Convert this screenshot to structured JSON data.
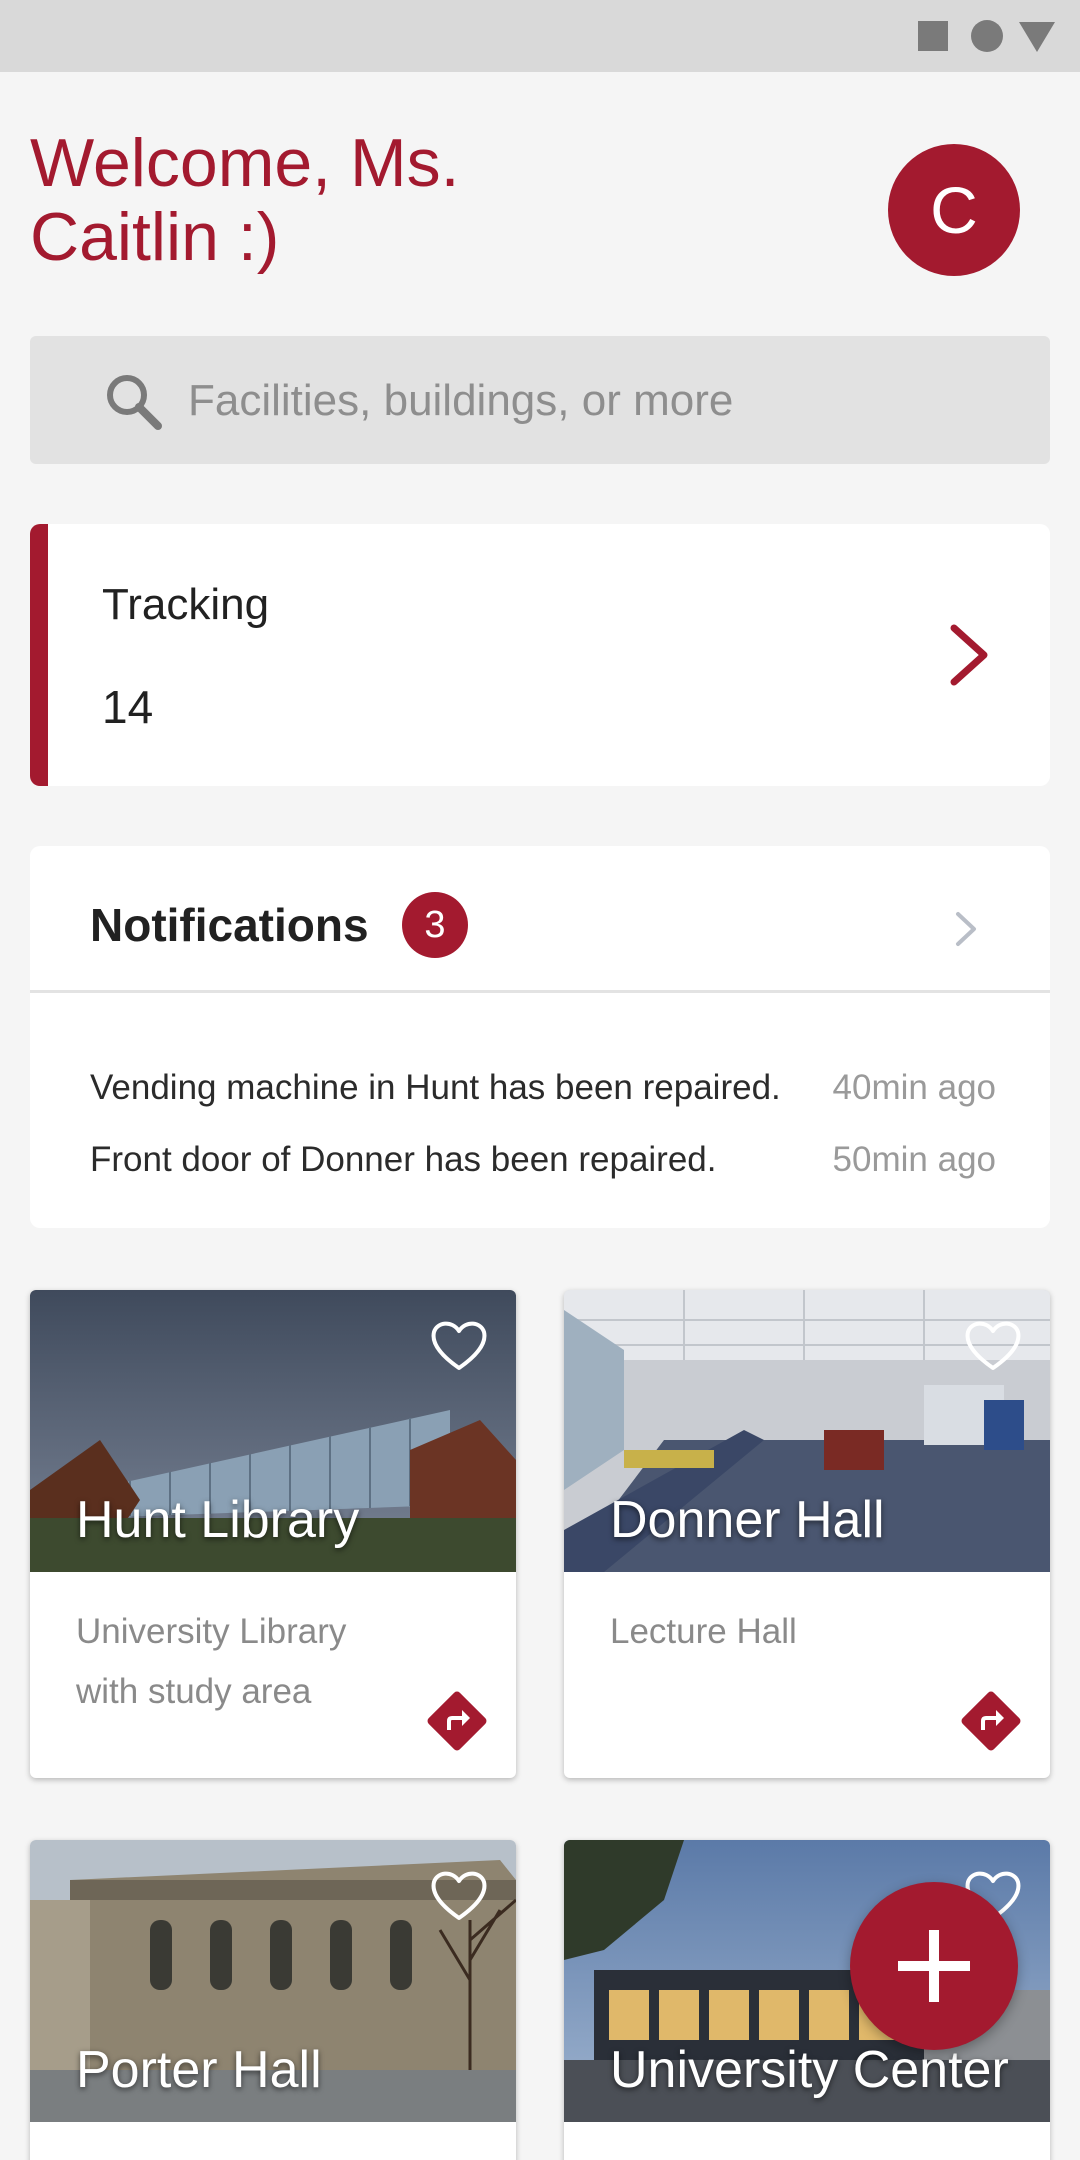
{
  "welcome": {
    "text": "Welcome, Ms. Caitlin :)"
  },
  "avatar": {
    "initial": "C"
  },
  "search": {
    "placeholder": "Facilities, buildings, or more"
  },
  "tracking": {
    "label": "Tracking",
    "count": "14"
  },
  "notifications": {
    "title": "Notifications",
    "badge": "3",
    "items": [
      {
        "text": "Vending machine in Hunt has been repaired.",
        "time": "40min ago"
      },
      {
        "text": "Front door of Donner has been repaired.",
        "time": "50min ago"
      }
    ]
  },
  "places": [
    {
      "name": "Hunt Library",
      "description": "University Library with study area"
    },
    {
      "name": "Donner Hall",
      "description": "Lecture Hall"
    },
    {
      "name": "Porter Hall",
      "description": ""
    },
    {
      "name": "University Center",
      "description": ""
    }
  ],
  "colors": {
    "accent": "#a31a2f",
    "background": "#f5f5f5",
    "search_bg": "#e2e2e2"
  },
  "icons": {
    "search": "search-icon",
    "tracking": "chevron-right-icon",
    "favorite": "heart-outline-icon",
    "directions": "directions-icon",
    "fab": "plus-icon"
  }
}
